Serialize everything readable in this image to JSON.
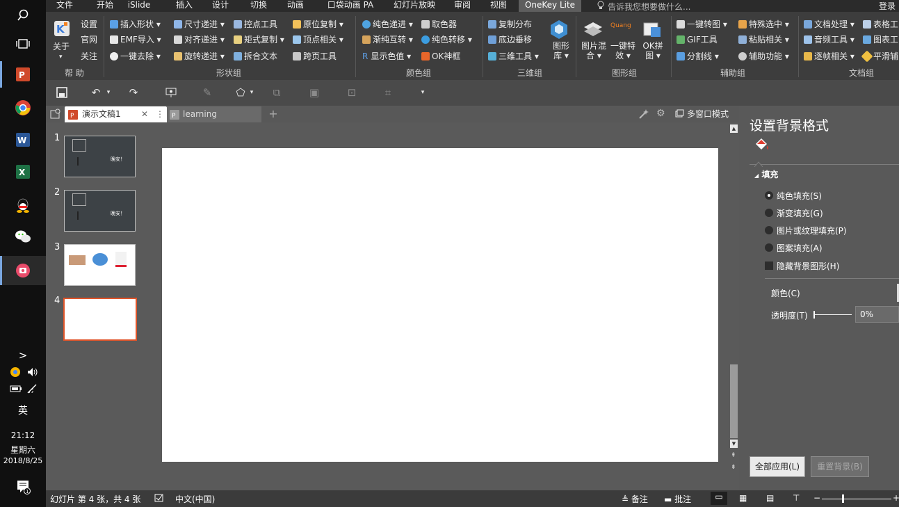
{
  "taskbar": {
    "time": "21:12",
    "weekday": "星期六",
    "date": "2018/8/25",
    "ime": "英",
    "expand": ">",
    "icons": [
      "search-icon",
      "task-view-icon",
      "powerpoint-icon",
      "chrome-icon",
      "word-icon",
      "excel-icon",
      "qq-icon",
      "wechat-icon",
      "capture-icon"
    ]
  },
  "tabs": [
    "文件",
    "开始",
    "iSlide",
    "插入",
    "设计",
    "切换",
    "动画",
    "口袋动画 PA",
    "幻灯片放映",
    "审阅",
    "视图",
    "OneKey Lite"
  ],
  "tell_me": "告诉我您想要做什么...",
  "login": "登录",
  "ribbon": {
    "help": {
      "label": "帮 助",
      "items": [
        "设置",
        "官网",
        "关注"
      ],
      "about": "关于"
    },
    "shape": {
      "label": "形状组",
      "col1": [
        "插入形状",
        "EMF导入",
        "一键去除"
      ],
      "col2": [
        "尺寸递进",
        "对齐递进",
        "旋转递进"
      ],
      "col3": [
        "控点工具",
        "矩式复制",
        "拆合文本"
      ],
      "col4": [
        "原位复制",
        "顶点相关",
        "跨页工具"
      ]
    },
    "color": {
      "label": "颜色组",
      "col1": [
        "纯色递进",
        "渐纯互转",
        "显示色值"
      ],
      "col2": [
        "取色器",
        "纯色转移",
        "OK神框"
      ]
    },
    "three": {
      "label": "三维组",
      "col1": [
        "复制分布",
        "底边垂移",
        "三维工具"
      ],
      "big": "图形库"
    },
    "graphic": {
      "label": "图形组",
      "big1": "图片混合",
      "big2": "一键特效",
      "big3": "OK拼图",
      "quang": "Quang"
    },
    "assist": {
      "label": "辅助组",
      "col1": [
        "一键转图",
        "GIF工具",
        "分割线"
      ],
      "col2": [
        "特殊选中",
        "粘贴相关",
        "辅助功能"
      ]
    },
    "doc": {
      "label": "文档组",
      "col1": [
        "文档处理",
        "音频工具",
        "逐帧相关"
      ],
      "col2": [
        "表格工",
        "图表工",
        "平滑辅"
      ]
    }
  },
  "doc_tabs": {
    "active": "演示文稿1",
    "other": "learning",
    "mode": "多窗口模式"
  },
  "slides": [
    {
      "num": "1",
      "text": "晚安！"
    },
    {
      "num": "2",
      "text": "晚安！"
    },
    {
      "num": "3",
      "text": ""
    },
    {
      "num": "4",
      "text": ""
    }
  ],
  "pane": {
    "title": "设置背景格式",
    "section": "填充",
    "options": [
      "纯色填充(S)",
      "渐变填充(G)",
      "图片或纹理填充(P)",
      "图案填充(A)"
    ],
    "hide_bg": "隐藏背景图形(H)",
    "color_label": "颜色(C)",
    "transparency_label": "透明度(T)",
    "transparency_value": "0%",
    "apply_all": "全部应用(L)",
    "reset": "重置背景(B)"
  },
  "status": {
    "slide_info": "幻灯片 第 4 张，共 4 张",
    "language": "中文(中国)",
    "notes": "备注",
    "comments": "批注"
  }
}
